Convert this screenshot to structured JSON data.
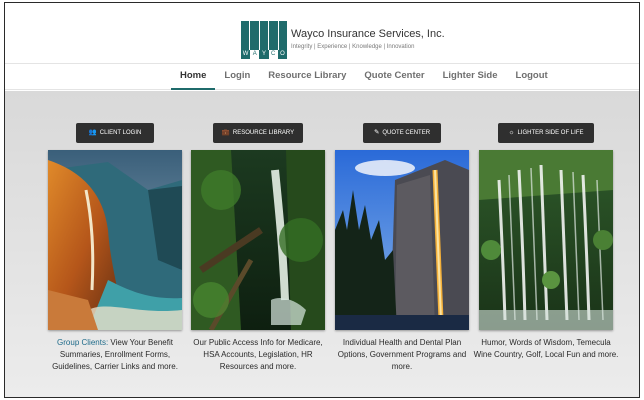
{
  "brand": {
    "name": "Wayco Insurance Services, Inc.",
    "tagline": "Integrity | Experience | Knowledge | Innovation",
    "letters": [
      "W",
      "A",
      "Y",
      "C",
      "O"
    ],
    "color": "#1f6b6b"
  },
  "nav": {
    "items": [
      {
        "label": "Home",
        "active": true
      },
      {
        "label": "Login",
        "active": false
      },
      {
        "label": "Resource Library",
        "active": false
      },
      {
        "label": "Quote Center",
        "active": false
      },
      {
        "label": "Lighter Side",
        "active": false
      },
      {
        "label": "Logout",
        "active": false
      }
    ]
  },
  "columns": [
    {
      "button": {
        "label": "CLIENT LOGIN",
        "icon": "users-icon",
        "glyph": "👥"
      },
      "image": "coastal-waterfall-sunset",
      "lead": "Group Clients:",
      "text": " View Your Benefit Summaries, Enrollment Forms, Guidelines, Carrier Links and more."
    },
    {
      "button": {
        "label": "RESOURCE LIBRARY",
        "icon": "briefcase-icon",
        "glyph": "💼"
      },
      "image": "forest-waterfall",
      "lead": "",
      "text": "Our Public Access Info for Medicare, HSA Accounts, Legislation, HR Resources and more."
    },
    {
      "button": {
        "label": "QUOTE CENTER",
        "icon": "pencil-icon",
        "glyph": "✎"
      },
      "image": "granite-cliff-firefall",
      "lead": "",
      "text": "Individual Health and Dental Plan Options, Government Programs and more."
    },
    {
      "button": {
        "label": "LIGHTER SIDE OF LIFE",
        "icon": "sun-icon",
        "glyph": "☼"
      },
      "image": "mossy-cascade-waterfall",
      "lead": "",
      "text": "Humor, Words of Wisdom, Temecula Wine Country, Golf, Local Fun and more."
    }
  ]
}
